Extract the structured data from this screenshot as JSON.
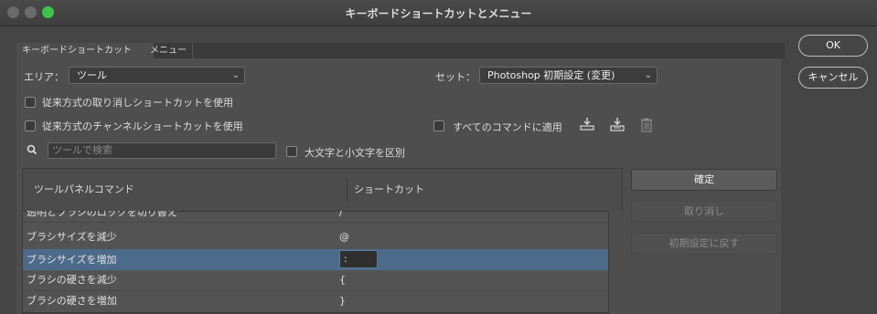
{
  "window": {
    "title": "キーボードショートカットとメニュー"
  },
  "tabs": [
    "キーボードショートカット",
    "メニュー"
  ],
  "area": {
    "label": "エリア：",
    "value": "ツール"
  },
  "set": {
    "label": "セット：",
    "value": "Photoshop 初期設定 (変更)"
  },
  "options": {
    "legacy_undo": "従来方式の取り消しショートカットを使用",
    "legacy_channel": "従来方式のチャンネルショートカットを使用",
    "apply_all": "すべてのコマンドに適用",
    "case_sensitive": "大文字と小文字を区別"
  },
  "search": {
    "placeholder": "ツールで検索"
  },
  "table": {
    "headers": {
      "command": "ツールパネルコマンド",
      "shortcut": "ショートカット"
    },
    "rows": [
      {
        "command": "透明とブラシのロックを切り替え",
        "shortcut": "/"
      },
      {
        "command": "ブラシサイズを減少",
        "shortcut": "@"
      },
      {
        "command": "ブラシサイズを増加",
        "shortcut": ":"
      },
      {
        "command": "ブラシの硬さを減少",
        "shortcut": "{"
      },
      {
        "command": "ブラシの硬さを増加",
        "shortcut": "}"
      }
    ]
  },
  "side_buttons": {
    "confirm": "確定",
    "undo": "取り消し",
    "reset": "初期設定に戻す"
  },
  "dialog_buttons": {
    "ok": "OK",
    "cancel": "キャンセル"
  },
  "icons": [
    "search-icon",
    "download-set-icon",
    "download-summary-icon",
    "trash-icon"
  ]
}
